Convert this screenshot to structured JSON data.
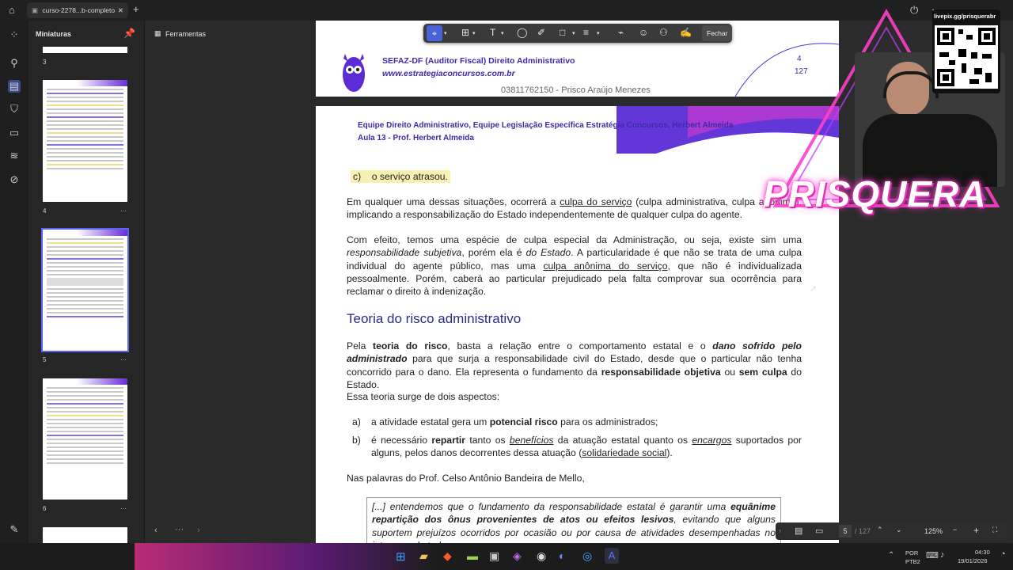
{
  "browser": {
    "tab_title": "curso-2278...b-completo"
  },
  "thumbnails": {
    "panel_title": "Miniaturas",
    "pages": [
      "3",
      "4",
      "5",
      "6"
    ]
  },
  "tools": {
    "label": "Ferramentas"
  },
  "toolbar": {
    "close_label": "Fechar"
  },
  "document": {
    "header_title": "SEFAZ-DF (Auditor Fiscal) Direito Administrativo",
    "header_site": "www.estrategiaconcursos.com.br",
    "header_owner": "03811762150 - Prisco Araújo Menezes",
    "page_num": "4",
    "page_total": "127",
    "team_line": "Equipe Direito Administrativo, Equipe Legislação Específica Estratégia Concursos, Herbert Almeida",
    "lesson_line": "Aula 13 - Prof. Herbert Almeida",
    "item_c": "c)    o serviço atrasou.",
    "p1_a": "Em qualquer uma dessas situações, ocorrerá a ",
    "p1_u": "culpa do serviço",
    "p1_b": " (culpa administrativa, culpa anônima), implicando a responsabilização do Estado independentemente de qualquer culpa do agente.",
    "p2_a": "Com efeito, temos uma espécie de culpa especial da Administração, ou seja, existe sim uma ",
    "p2_i": "responsabilidade subjetiva",
    "p2_b": ", porém ela é ",
    "p2_i2": "do Estado",
    "p2_c": ". A particularidade é que não se trata de uma culpa individual do agente público, mas uma ",
    "p2_u": "culpa anônima do serviço",
    "p2_d": ", que não é individualizada pessoalmente. Porém, caberá ao particular prejudicado pela falta comprovar sua ocorrência para reclamar o direito à indenização.",
    "section_title": "Teoria do risco administrativo",
    "p3_a": "Pela ",
    "p3_b1": "teoria do risco",
    "p3_b": ", basta a relação entre o comportamento estatal e o ",
    "p3_bi": "dano sofrido pelo administrado",
    "p3_c": " para que surja a responsabilidade civil do Estado, desde que o particular não tenha concorrido para o dano. Ela representa o fundamento da ",
    "p3_b2": "responsabilidade objetiva",
    "p3_d": " ou ",
    "p3_b3": "sem culpa",
    "p3_e": " do Estado.",
    "p4": "Essa teoria surge de dois aspectos:",
    "a_label": "a)",
    "a_1": "a atividade estatal gera um ",
    "a_b": "potencial risco",
    "a_2": " para os administrados;",
    "b_label": "b)",
    "b_1": "é necessário ",
    "b_b": "repartir",
    "b_2": " tanto os ",
    "b_iu1": "benefícios",
    "b_3": " da atuação estatal quanto os ",
    "b_iu2": "encargos",
    "b_4": " suportados por alguns, pelos danos decorrentes dessa atuação (",
    "b_u": "solidariedade social",
    "b_5": ").",
    "p5": "Nas palavras do Prof. Celso Antônio Bandeira de Mello,",
    "q_1": "[...] entendemos que o fundamento da responsabilidade estatal é garantir uma ",
    "q_b": "equânime repartição dos ônus provenientes de atos ou efeitos lesivos",
    "q_2": ", evitando que alguns suportem prejuízos ocorridos por ocasião ou por causa de atividades desempenhadas no interesse de todos."
  },
  "stream": {
    "qr_label": "livepix.gg/prisquerabr",
    "brand": "PRISQUERA"
  },
  "status": {
    "current_page": "5",
    "total_pages": "/ 127",
    "zoom": "125%"
  },
  "taskbar": {
    "lang_1": "POR",
    "lang_2": "PTB2",
    "time": "04:30",
    "date": "19/01/2026"
  },
  "colors": {
    "accent_purple": "#5b2bd6",
    "header_blue": "#3a2ca8",
    "section_blue": "#2c2a8f",
    "neon_pink": "#ff3ec9"
  }
}
